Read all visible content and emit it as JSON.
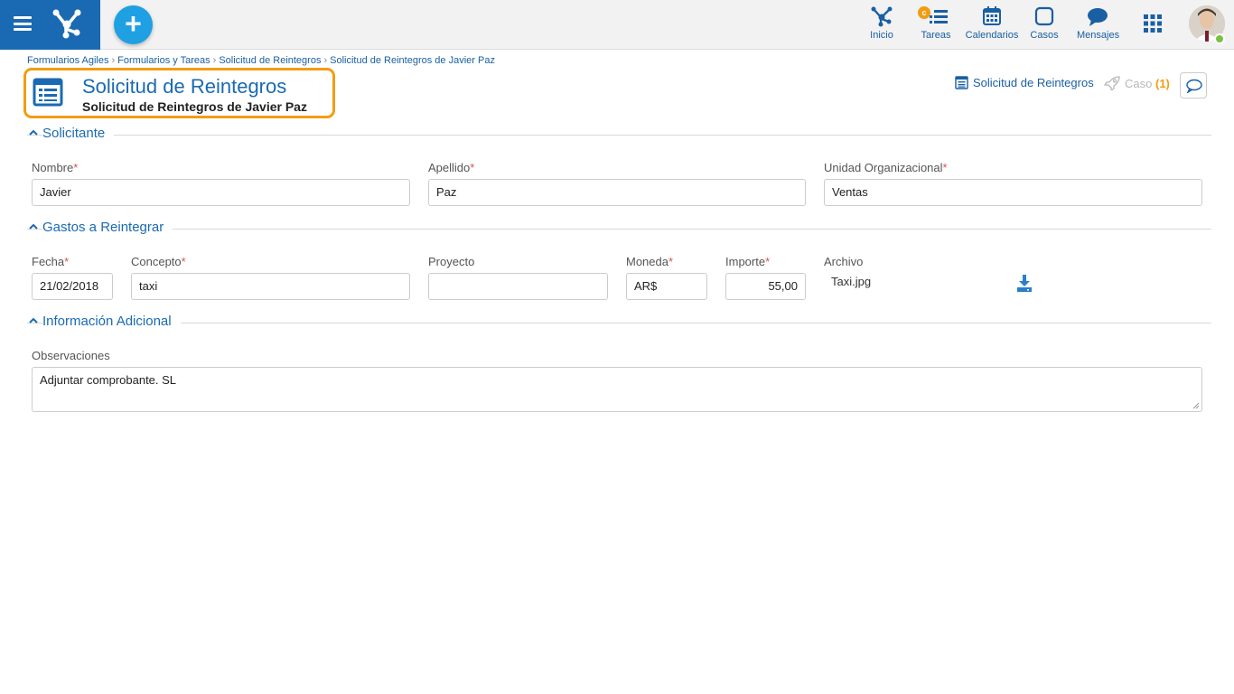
{
  "nav": {
    "items": [
      {
        "label": "Inicio"
      },
      {
        "label": "Tareas",
        "badge": "c"
      },
      {
        "label": "Calendarios"
      },
      {
        "label": "Casos"
      },
      {
        "label": "Mensajes"
      }
    ]
  },
  "breadcrumb": [
    "Formularios Agiles",
    "Formularios y Tareas",
    "Solicitud de Reintegros",
    "Solicitud de Reintegros de Javier Paz"
  ],
  "header": {
    "title": "Solicitud de Reintegros",
    "subtitle": "Solicitud de Reintegros de Javier Paz",
    "form_link": "Solicitud de Reintegros",
    "case_label": "Caso",
    "case_count": "(1)"
  },
  "sections": {
    "solicitante": {
      "title": "Solicitante",
      "nombre_label": "Nombre",
      "nombre_value": "Javier",
      "apellido_label": "Apellido",
      "apellido_value": "Paz",
      "unidad_label": "Unidad Organizacional",
      "unidad_value": "Ventas"
    },
    "gastos": {
      "title": "Gastos a Reintegrar",
      "fecha_label": "Fecha",
      "fecha_value": "21/02/2018",
      "concepto_label": "Concepto",
      "concepto_value": "taxi",
      "proyecto_label": "Proyecto",
      "proyecto_value": "",
      "moneda_label": "Moneda",
      "moneda_value": "AR$",
      "importe_label": "Importe",
      "importe_value": "55,00",
      "archivo_label": "Archivo",
      "archivo_value": "Taxi.jpg"
    },
    "adicional": {
      "title": "Información Adicional",
      "observaciones_label": "Observaciones",
      "observaciones_value": "Adjuntar comprobante. SL"
    }
  },
  "colors": {
    "brand": "#1a6ab3",
    "accent": "#1fa0e3",
    "highlight": "#f39c12",
    "required": "#d9534f"
  }
}
